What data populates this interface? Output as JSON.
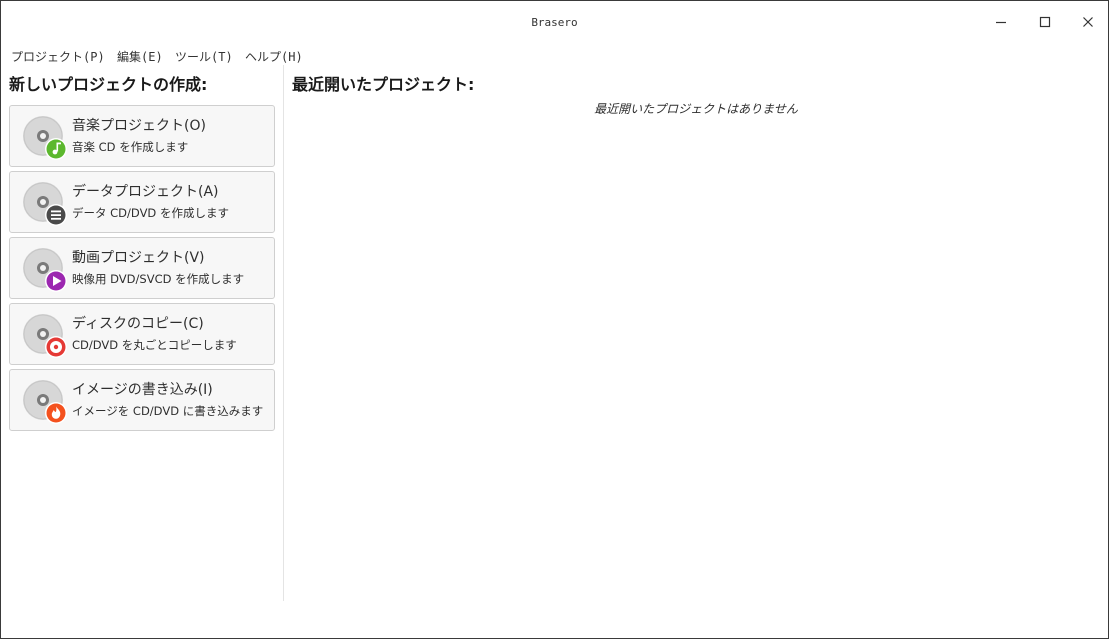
{
  "window": {
    "title": "Brasero"
  },
  "menu": [
    {
      "label": "プロジェクト(P)"
    },
    {
      "label": "編集(E)"
    },
    {
      "label": "ツール(T)"
    },
    {
      "label": "ヘルプ(H)"
    }
  ],
  "new_project": {
    "heading": "新しいプロジェクトの作成:",
    "items": [
      {
        "label": "音楽プロジェクト(O)",
        "desc": "音楽 CD を作成します",
        "badge_color": "#5cb82e",
        "badge_icon": "music-note-icon"
      },
      {
        "label": "データプロジェクト(A)",
        "desc": "データ CD/DVD を作成します",
        "badge_color": "#4a4a4a",
        "badge_icon": "list-icon"
      },
      {
        "label": "動画プロジェクト(V)",
        "desc": "映像用 DVD/SVCD を作成します",
        "badge_color": "#9c27b0",
        "badge_icon": "play-icon"
      },
      {
        "label": "ディスクのコピー(C)",
        "desc": "CD/DVD を丸ごとコピーします",
        "badge_color": "#e53935",
        "badge_icon": "disc-copy-icon"
      },
      {
        "label": "イメージの書き込み(I)",
        "desc": "イメージを CD/DVD に書き込みます",
        "badge_color": "#f4511e",
        "badge_icon": "flame-icon"
      }
    ]
  },
  "recent": {
    "heading": "最近開いたプロジェクト:",
    "empty_message": "最近開いたプロジェクトはありません"
  },
  "colors": {
    "window_border": "#3a3a3a",
    "button_bg": "#f7f7f7",
    "button_border": "#cfcfcf",
    "disc_gray": "#d7d7d7"
  }
}
